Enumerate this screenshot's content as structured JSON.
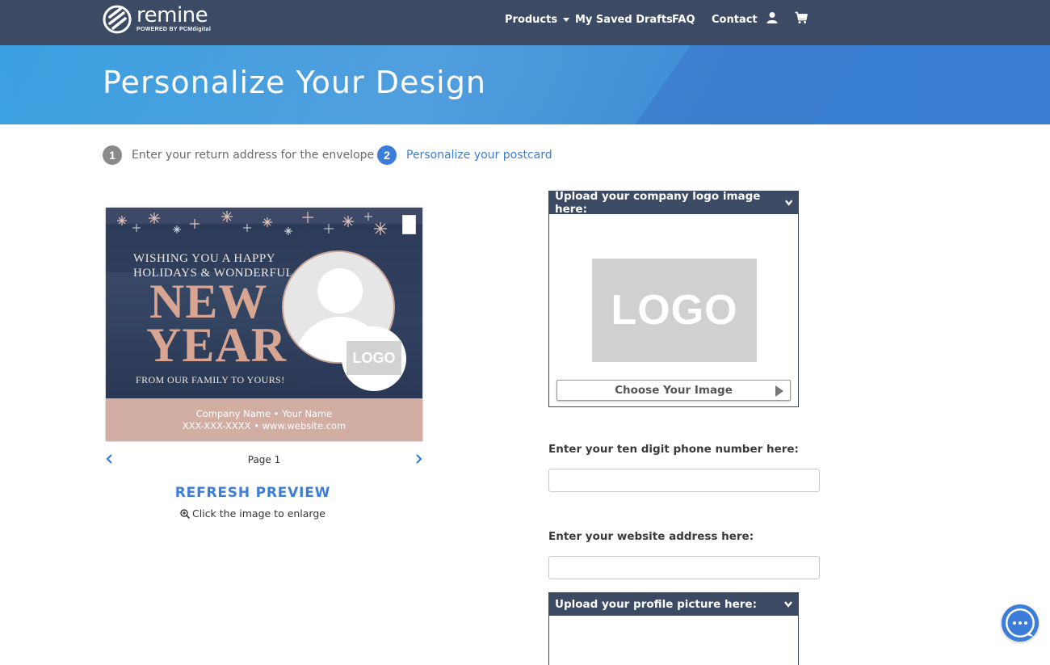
{
  "brand": {
    "name": "remine",
    "sub": "POWERED BY PCMdigital"
  },
  "nav": {
    "items": [
      {
        "label": "Products"
      },
      {
        "label": "My Saved Drafts"
      },
      {
        "label": "FAQ"
      },
      {
        "label": "Contact"
      }
    ],
    "icons": [
      "user-icon",
      "cart-icon"
    ]
  },
  "hero": {
    "title": "Personalize Your Design"
  },
  "steps": [
    {
      "number": "1",
      "label": "Enter your return address for the envelope",
      "active": false
    },
    {
      "number": "2",
      "label": "Personalize your postcard",
      "active": true
    }
  ],
  "preview": {
    "card": {
      "greeting_line1": "WISHING YOU A HAPPY",
      "greeting_line2": "HOLIDAYS & WONDERFUL",
      "big_line1": "NEW",
      "big_line2": "YEAR",
      "family": "FROM OUR FAMILY TO YOURS!",
      "logo_text": "LOGO",
      "footer_line1": "Company Name • Your Name",
      "footer_line2": "XXX-XXX-XXXX • www.website.com"
    },
    "page_label": "Page 1",
    "refresh_label": "REFRESH PREVIEW",
    "enlarge_hint": "Click the image to enlarge"
  },
  "form": {
    "logo_panel": {
      "title": "Upload your company logo image here:",
      "placeholder_text": "LOGO",
      "button_label": "Choose Your Image"
    },
    "phone": {
      "label": "Enter your ten digit phone number here:",
      "value": ""
    },
    "website": {
      "label": "Enter your website address here:",
      "value": ""
    },
    "profile_panel": {
      "title": "Upload your profile picture here:"
    }
  },
  "colors": {
    "navbar": "#3d4a63",
    "accent": "#3b7dd8",
    "hero": "#3e8fd8",
    "card_footer": "#d1ada2"
  }
}
